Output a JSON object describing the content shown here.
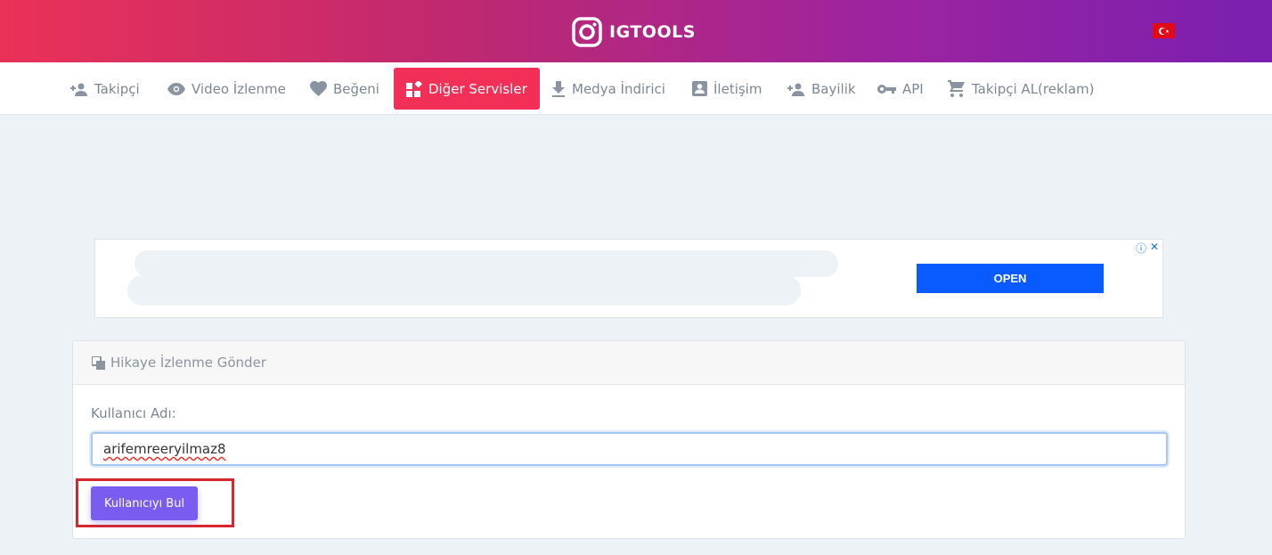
{
  "header": {
    "logo_text": "IGTOOLS",
    "language_flag": "turkey-flag"
  },
  "nav": {
    "items": [
      {
        "label": "Takipçi",
        "icon": "person-add-icon"
      },
      {
        "label": "Video İzlenme",
        "icon": "eye-icon"
      },
      {
        "label": "Beğeni",
        "icon": "heart-icon"
      },
      {
        "label": "Diğer Servisler",
        "icon": "widgets-icon",
        "active": true
      },
      {
        "label": "Medya İndirici",
        "icon": "download-icon"
      },
      {
        "label": "İletişim",
        "icon": "contact-icon"
      },
      {
        "label": "Bayilik",
        "icon": "person-add-icon"
      },
      {
        "label": "API",
        "icon": "key-icon"
      },
      {
        "label": "Takipçi AL(reklam)",
        "icon": "cart-icon"
      }
    ]
  },
  "ad": {
    "open_label": "OPEN",
    "info_symbol": "ⓘ",
    "close_symbol": "✕"
  },
  "card": {
    "title": "Hikaye İzlenme Gönder",
    "field_label": "Kullanıcı Adı:",
    "username_value": "arifemreeryilmaz8",
    "button_label": "Kullanıcıyı Bul"
  },
  "colors": {
    "gradient_start": "#ea3158",
    "gradient_end": "#7a1fb0",
    "active_nav": "#f22f56",
    "primary_button": "#7a5cf0",
    "ad_button": "#0a5bff",
    "highlight_box": "#d8262c"
  }
}
